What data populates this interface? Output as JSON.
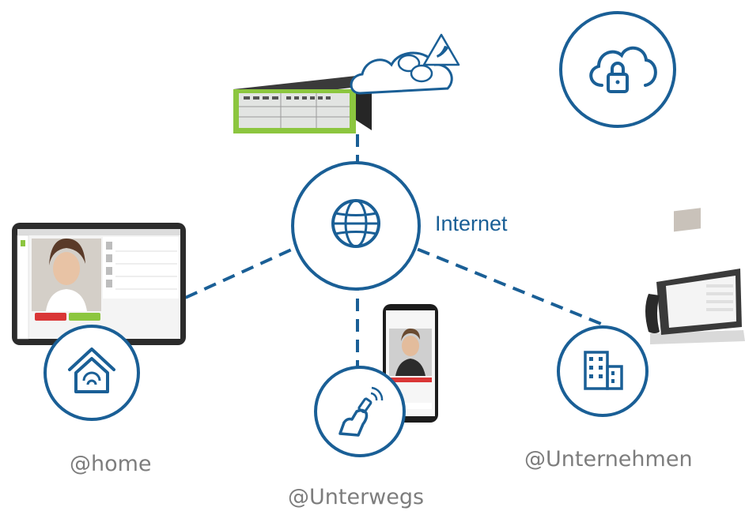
{
  "colors": {
    "primary": "#1a5f96",
    "label": "#7d7d7d",
    "accent_green": "#8cc63f",
    "decline_red": "#d93636"
  },
  "labels": {
    "internet": "Internet",
    "home": "@home",
    "unterwegs": "@Unterwegs",
    "unternehmen": "@Unternehmen"
  },
  "icons": {
    "center": "globe-icon",
    "cloud_secure": "cloud-lock-icon",
    "home": "home-wifi-icon",
    "mobile": "mobile-person-icon",
    "office": "office-building-icon",
    "cloud_chat": "cloud-chat-icon"
  }
}
